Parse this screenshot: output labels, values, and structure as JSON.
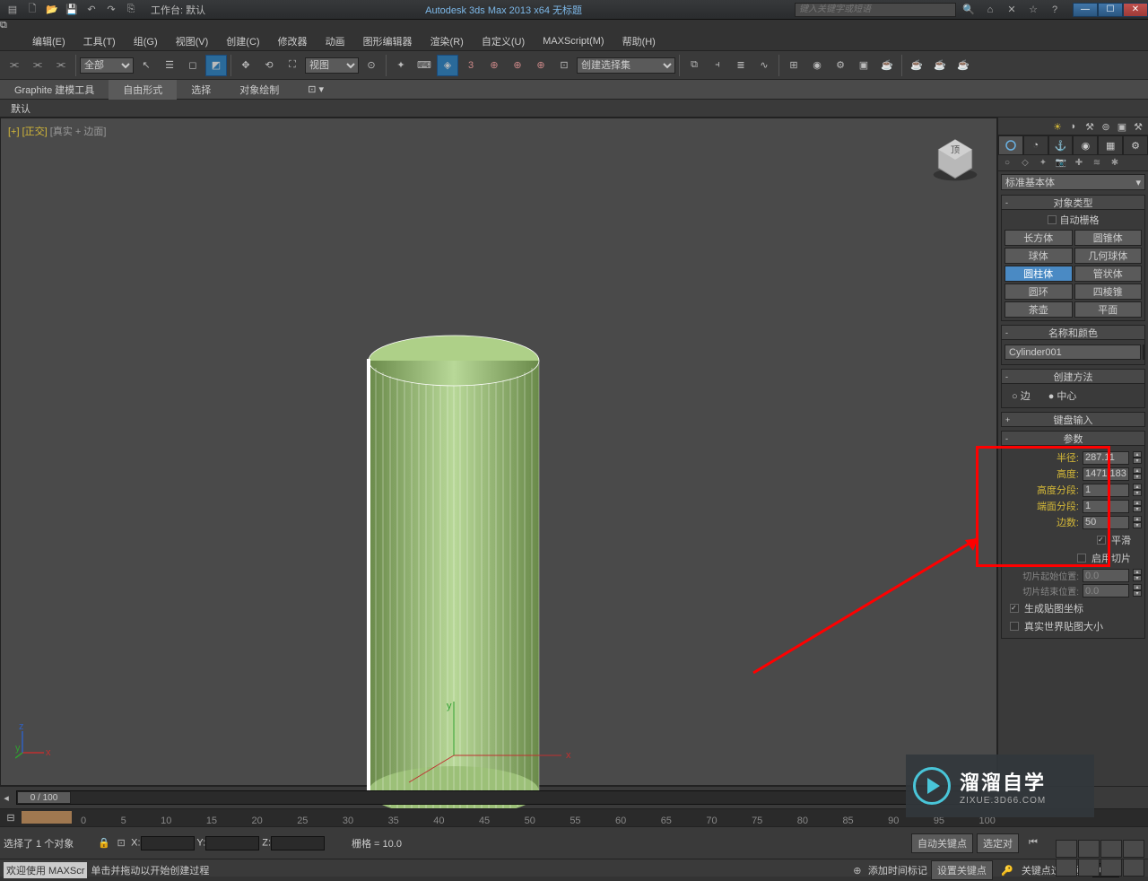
{
  "titlebar": {
    "workspace": "工作台: 默认",
    "title": "Autodesk 3ds Max  2013 x64     无标题",
    "search_placeholder": "键入关键字或短语"
  },
  "menu": [
    "编辑(E)",
    "工具(T)",
    "组(G)",
    "视图(V)",
    "创建(C)",
    "修改器",
    "动画",
    "图形编辑器",
    "渲染(R)",
    "自定义(U)",
    "MAXScript(M)",
    "帮助(H)"
  ],
  "toolbar": {
    "sel_filter": "全部",
    "view_label": "视图",
    "named_set": "创建选择集"
  },
  "ribbon": {
    "tabs": [
      "Graphite 建模工具",
      "自由形式",
      "选择",
      "对象绘制"
    ],
    "active": 1,
    "sub": "默认"
  },
  "viewport": {
    "label_prefix": "[+]",
    "label_view": "[正交]",
    "label_shade": "[真实 + 边面]"
  },
  "cmd": {
    "dropdown": "标准基本体",
    "rollup_type": "对象类型",
    "auto_grid": "自动栅格",
    "objs": [
      "长方体",
      "圆锥体",
      "球体",
      "几何球体",
      "圆柱体",
      "管状体",
      "圆环",
      "四棱锥",
      "茶壶",
      "平面"
    ],
    "obj_active": 4,
    "rollup_name": "名称和颜色",
    "name_value": "Cylinder001",
    "rollup_method": "创建方法",
    "edge": "边",
    "center": "中心",
    "rollup_kb": "键盘输入",
    "rollup_param": "参数",
    "p": {
      "radius_l": "半径:",
      "radius_v": "287.11",
      "height_l": "高度:",
      "height_v": "1471.183",
      "hseg_l": "高度分段:",
      "hseg_v": "1",
      "cseg_l": "端面分段:",
      "cseg_v": "1",
      "sides_l": "边数:",
      "sides_v": "50"
    },
    "smooth": "平滑",
    "slice_on": "启用切片",
    "slice_from": "切片起始位置:",
    "slice_to": "切片结束位置:",
    "slice_zero": "0.0",
    "gen_map": "生成贴图坐标",
    "real_world": "真实世界贴图大小"
  },
  "time": {
    "slider": "0 / 100"
  },
  "status": {
    "sel": "选择了 1 个对象",
    "prompt": "单击并拖动以开始创建过程",
    "x": "X:",
    "y": "Y:",
    "z": "Z:",
    "grid": "栅格 = 10.0",
    "add_tag": "添加时间标记",
    "autokey": "自动关键点",
    "setkey": "设置关键点",
    "selkey": "选定对",
    "keyfilter": "关键点过滤器...",
    "welcome": "欢迎使用  MAXScr"
  },
  "track_ticks": [
    "0",
    "5",
    "10",
    "15",
    "20",
    "25",
    "30",
    "35",
    "40",
    "45",
    "50",
    "55",
    "60",
    "65",
    "70",
    "75",
    "80",
    "85",
    "90",
    "95",
    "100"
  ],
  "watermark": {
    "big": "溜溜自学",
    "small": "ZIXUE.3D66.COM"
  }
}
